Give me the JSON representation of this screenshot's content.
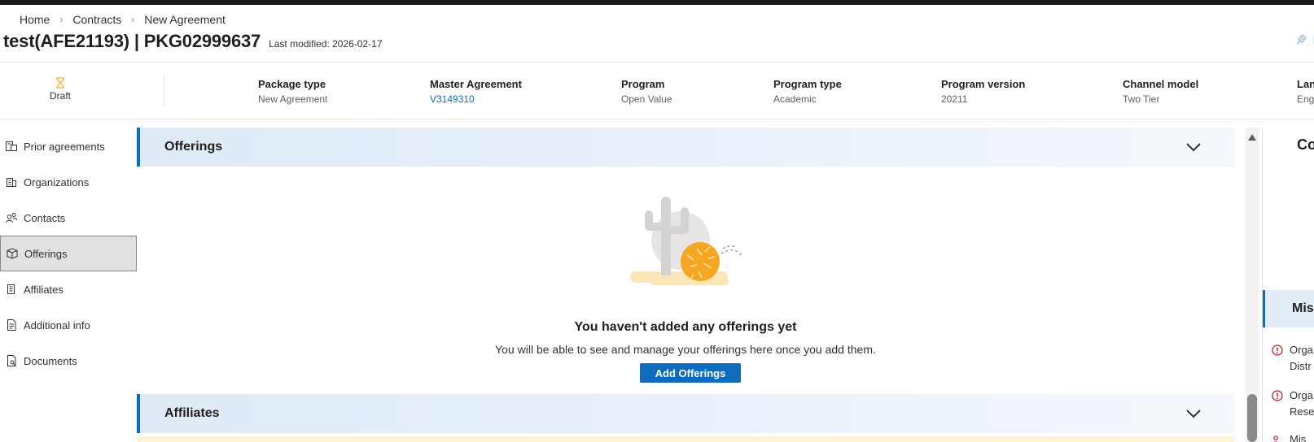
{
  "breadcrumb": {
    "items": [
      "Home",
      "Contracts",
      "New Agreement"
    ]
  },
  "header": {
    "title": "test(AFE21193) | PKG02999637",
    "last_modified": "Last modified: 2026-02-17",
    "right_link": "In"
  },
  "status": {
    "label": "Draft"
  },
  "meta": [
    {
      "label": "Package type",
      "value": "New Agreement"
    },
    {
      "label": "Master Agreement",
      "value": "V3149310"
    },
    {
      "label": "Program",
      "value": "Open Value"
    },
    {
      "label": "Program type",
      "value": "Academic"
    },
    {
      "label": "Program version",
      "value": "20211"
    },
    {
      "label": "Channel model",
      "value": "Two Tier"
    },
    {
      "label": "Lan",
      "value": "Eng"
    }
  ],
  "sidebar": {
    "items": [
      {
        "label": "Prior agreements",
        "icon": "prior-agreements-icon"
      },
      {
        "label": "Organizations",
        "icon": "building-icon"
      },
      {
        "label": "Contacts",
        "icon": "people-icon"
      },
      {
        "label": "Offerings",
        "icon": "box-icon",
        "active": true
      },
      {
        "label": "Affiliates",
        "icon": "affiliate-building-icon"
      },
      {
        "label": "Additional info",
        "icon": "document-lines-icon"
      },
      {
        "label": "Documents",
        "icon": "document-search-icon"
      }
    ]
  },
  "offerings": {
    "title": "Offerings",
    "empty_title": "You haven't added any offerings yet",
    "empty_desc": "You will be able to see and manage your offerings here once you add them.",
    "add_button": "Add Offerings"
  },
  "affiliates": {
    "title": "Affiliates"
  },
  "right_panel": {
    "title": "Co",
    "missing_title": "Miss",
    "items": [
      {
        "line1": "Orga",
        "line2": "Distr"
      },
      {
        "line1": "Orga",
        "line2": "Rese"
      },
      {
        "line1": "Mis",
        "line2": ""
      }
    ]
  },
  "colors": {
    "accent": "#0f6cbd",
    "status_draft": "#f2b01e",
    "error": "#c50f1f",
    "warning_strip": "#fdf3d6"
  }
}
